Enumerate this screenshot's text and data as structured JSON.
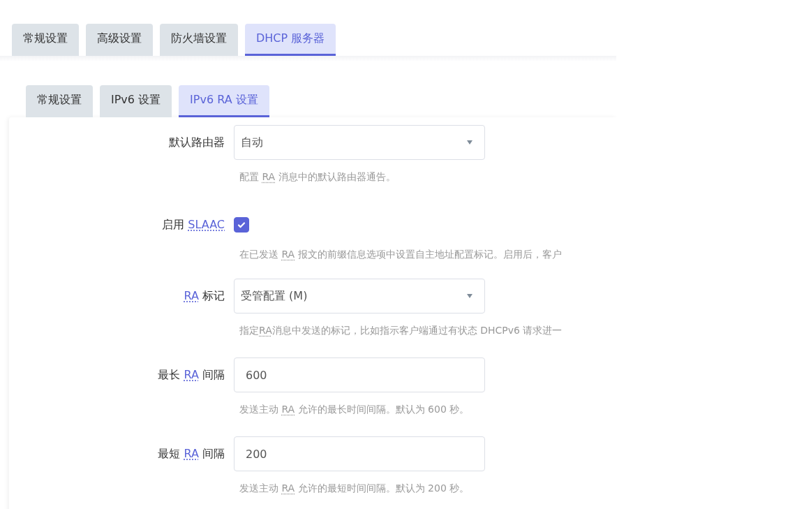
{
  "tabs": [
    {
      "label": "常规设置",
      "selected": false
    },
    {
      "label": "高级设置",
      "selected": false
    },
    {
      "label": "防火墙设置",
      "selected": false
    },
    {
      "label": "DHCP 服务器",
      "selected": true
    }
  ],
  "subtabs": [
    {
      "label": "常规设置",
      "selected": false
    },
    {
      "label": "IPv6 设置",
      "selected": false
    },
    {
      "label": "IPv6 RA 设置",
      "selected": true
    }
  ],
  "fields": [
    {
      "kind": "select",
      "label": [
        {
          "text": "默认路由器",
          "abbr": false
        }
      ],
      "value": "自动",
      "help": [
        {
          "text": "配置 ",
          "abbr": false
        },
        {
          "text": "RA",
          "abbr": true
        },
        {
          "text": " 消息中的默认路由器通告。",
          "abbr": false
        }
      ]
    },
    {
      "kind": "checkbox",
      "label": [
        {
          "text": "启用 ",
          "abbr": false
        },
        {
          "text": "SLAAC",
          "abbr": true
        }
      ],
      "checked": true,
      "help": [
        {
          "text": "在已发送 ",
          "abbr": false
        },
        {
          "text": "RA",
          "abbr": true
        },
        {
          "text": " 报文的前缀信息选项中设置自主地址配置标记。启用后，客户",
          "abbr": false
        }
      ]
    },
    {
      "kind": "select",
      "label": [
        {
          "text": "RA",
          "abbr": true
        },
        {
          "text": " 标记",
          "abbr": false
        }
      ],
      "value": "受管配置 (M)",
      "help": [
        {
          "text": "指定",
          "abbr": false
        },
        {
          "text": "RA",
          "abbr": true
        },
        {
          "text": "消息中发送的标记，比如指示客户端通过有状态 DHCPv6 请求进一",
          "abbr": false
        }
      ]
    },
    {
      "kind": "text",
      "label": [
        {
          "text": "最长 ",
          "abbr": false
        },
        {
          "text": "RA",
          "abbr": true
        },
        {
          "text": " 间隔",
          "abbr": false
        }
      ],
      "value": "600",
      "help": [
        {
          "text": "发送主动 ",
          "abbr": false
        },
        {
          "text": "RA",
          "abbr": true
        },
        {
          "text": " 允许的最长时间间隔。默认为 600 秒。",
          "abbr": false
        }
      ]
    },
    {
      "kind": "text",
      "label": [
        {
          "text": "最短 ",
          "abbr": false
        },
        {
          "text": "RA",
          "abbr": true
        },
        {
          "text": " 间隔",
          "abbr": false
        }
      ],
      "value": "200",
      "help": [
        {
          "text": "发送主动 ",
          "abbr": false
        },
        {
          "text": "RA",
          "abbr": true
        },
        {
          "text": " 允许的最短时间间隔。默认为 200 秒。",
          "abbr": false
        }
      ]
    }
  ]
}
